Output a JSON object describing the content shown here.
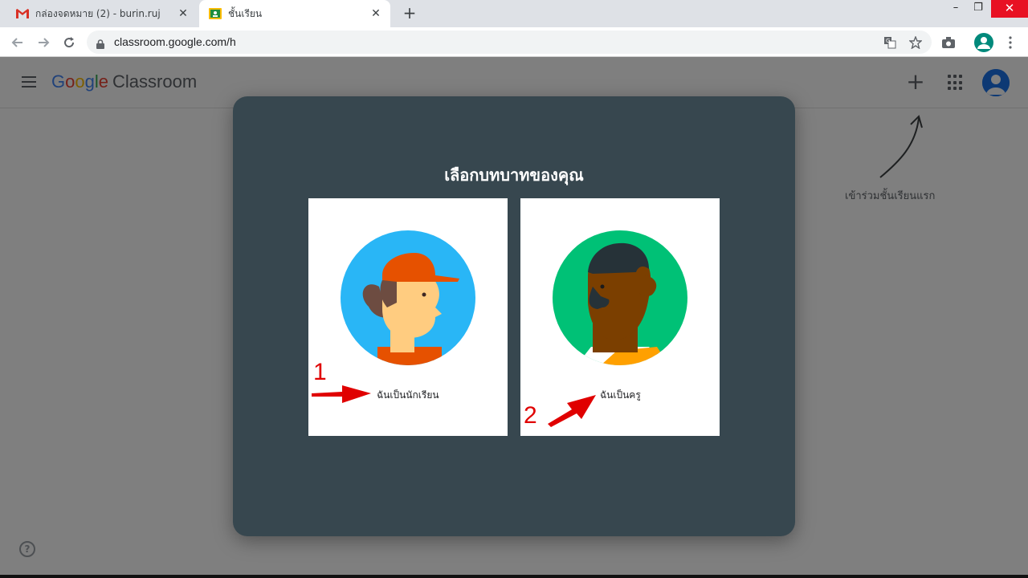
{
  "browser": {
    "tabs": [
      {
        "title": "กล่องจดหมาย (2) - burin.ruj",
        "favicon": "gmail-icon",
        "active": false
      },
      {
        "title": "ชั้นเรียน",
        "favicon": "classroom-icon",
        "active": true
      }
    ],
    "new_tab": "+",
    "url": "classroom.google.com/h",
    "window_controls": {
      "minimize": "–",
      "restore": "❐",
      "close": "✕"
    }
  },
  "appbar": {
    "logo_google": [
      "G",
      "o",
      "o",
      "g",
      "l",
      "e"
    ],
    "logo_product": "Classroom",
    "plus": "+"
  },
  "hint": {
    "text": "เข้าร่วมชั้นเรียนแรก"
  },
  "help": "?",
  "dialog": {
    "title": "เลือกบทบาทของคุณ",
    "roles": [
      {
        "label": "ฉันเป็นนักเรียน",
        "icon": "student-avatar-icon"
      },
      {
        "label": "ฉันเป็นครู",
        "icon": "teacher-avatar-icon"
      }
    ]
  },
  "annotations": {
    "num1": "1",
    "num2": "2"
  },
  "colors": {
    "dialog_bg": "#37474f",
    "student_circle": "#29b6f6",
    "teacher_circle": "#00c176",
    "annotation_red": "#e00000"
  }
}
